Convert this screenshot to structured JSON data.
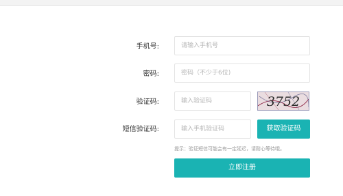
{
  "form": {
    "phone": {
      "label": "手机号:",
      "placeholder": "请输入手机号"
    },
    "password": {
      "label": "密码:",
      "placeholder": "密码（不少于6位)"
    },
    "captcha": {
      "label": "验证码:",
      "placeholder": "输入验证码",
      "image_text": "3752"
    },
    "sms_code": {
      "label": "短信验证码:",
      "placeholder": "输入手机验证码",
      "button_label": "获取验证码"
    },
    "hint": "提示：验证短信可能会有一定延迟，请耐心等待哦。",
    "submit_label": "立即注册"
  },
  "colors": {
    "accent": "#1ab3b3",
    "captcha_bg": "#e9dcdf",
    "captcha_text": "#2a2a2a"
  }
}
